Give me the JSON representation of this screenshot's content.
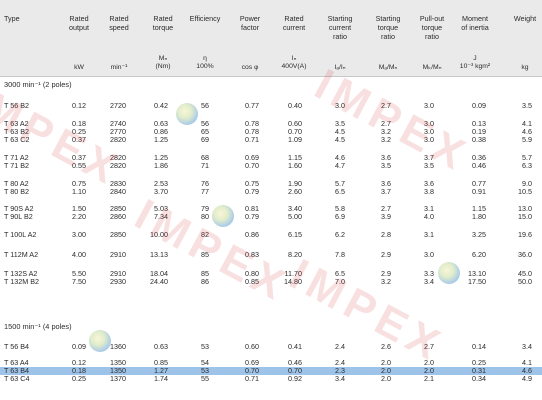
{
  "headers": [
    {
      "key": "type",
      "label": "Type",
      "unit": ""
    },
    {
      "key": "output",
      "label": "Rated\noutput",
      "unit": "kW"
    },
    {
      "key": "speed",
      "label": "Rated\nspeed",
      "unit": "min⁻¹"
    },
    {
      "key": "torque",
      "label": "Rated\ntorque",
      "unit": "Mₙ\n(Nm)"
    },
    {
      "key": "eff",
      "label": "Efficiency",
      "unit": "η\n100%"
    },
    {
      "key": "pf",
      "label": "Power\nfactor",
      "unit": "cos φ"
    },
    {
      "key": "current",
      "label": "Rated\ncurrent",
      "unit": "Iₙ\n400V(A)"
    },
    {
      "key": "scr",
      "label": "Starting\ncurrent\nratio",
      "unit": "Iₐ/Iₙ"
    },
    {
      "key": "str",
      "label": "Starting\ntorque\nratio",
      "unit": "Mₐ/Mₙ"
    },
    {
      "key": "potr",
      "label": "Pull-out\ntorque\nratio",
      "unit": "Mₖ/Mₙ"
    },
    {
      "key": "moi",
      "label": "Moment\nof inertia",
      "unit": "J\n10⁻³ kgm²"
    },
    {
      "key": "weight",
      "label": "Weight",
      "unit": "kg"
    }
  ],
  "sections": [
    {
      "title": "3000 min⁻¹ (2 poles)",
      "rows": [
        [
          "T 56 B2",
          "0.12",
          "2720",
          "0.42",
          "56",
          "0.77",
          "0.40",
          "3.0",
          "2.7",
          "3.0",
          "0.09",
          "3.5"
        ],
        [
          "T 63 A2",
          "0.18",
          "2740",
          "0.63",
          "56",
          "0.78",
          "0.60",
          "3.5",
          "2.7",
          "3.0",
          "0.13",
          "4.1"
        ],
        [
          "T 63 B2",
          "0.25",
          "2770",
          "0.86",
          "65",
          "0.78",
          "0.70",
          "4.5",
          "3.2",
          "3.0",
          "0.19",
          "4.6"
        ],
        [
          "T 63 C2",
          "0.37",
          "2820",
          "1.25",
          "69",
          "0.71",
          "1.09",
          "4.5",
          "3.2",
          "3.0",
          "0.38",
          "5.9"
        ],
        [
          "T 71 A2",
          "0.37",
          "2820",
          "1.25",
          "68",
          "0.69",
          "1.15",
          "4.6",
          "3.6",
          "3.7",
          "0.36",
          "5.7"
        ],
        [
          "T 71 B2",
          "0.55",
          "2820",
          "1.86",
          "71",
          "0.70",
          "1.60",
          "4.7",
          "3.5",
          "3.5",
          "0.46",
          "6.3"
        ],
        [
          "T 80 A2",
          "0.75",
          "2830",
          "2.53",
          "76",
          "0.75",
          "1.90",
          "5.7",
          "3.6",
          "3.6",
          "0.77",
          "9.0"
        ],
        [
          "T 80 B2",
          "1.10",
          "2840",
          "3.70",
          "77",
          "0.79",
          "2.60",
          "6.5",
          "3.7",
          "3.8",
          "0.91",
          "10.5"
        ],
        [
          "T 90S A2",
          "1.50",
          "2850",
          "5.03",
          "79",
          "0.81",
          "3.40",
          "5.8",
          "2.7",
          "3.1",
          "1.15",
          "13.0"
        ],
        [
          "T 90L B2",
          "2.20",
          "2860",
          "7.34",
          "80",
          "0.79",
          "5.00",
          "6.9",
          "3.9",
          "4.0",
          "1.80",
          "15.0"
        ],
        [
          "T 100L A2",
          "3.00",
          "2850",
          "10.00",
          "82",
          "0.86",
          "6.15",
          "6.2",
          "2.8",
          "3.1",
          "3.25",
          "19.6"
        ],
        [
          "T 112M A2",
          "4.00",
          "2910",
          "13.13",
          "85",
          "0.83",
          "8.20",
          "7.8",
          "2.9",
          "3.0",
          "6.20",
          "36.0"
        ],
        [
          "T 132S A2",
          "5.50",
          "2910",
          "18.04",
          "85",
          "0.80",
          "11.70",
          "6.5",
          "2.9",
          "3.3",
          "13.10",
          "45.0"
        ],
        [
          "T 132M B2",
          "7.50",
          "2930",
          "24.40",
          "86",
          "0.85",
          "14.80",
          "7.0",
          "3.2",
          "3.4",
          "17.50",
          "50.0"
        ]
      ]
    },
    {
      "title": "1500 min⁻¹ (4 poles)",
      "rows": [
        [
          "T 56 B4",
          "0.09",
          "1360",
          "0.63",
          "53",
          "0.60",
          "0.41",
          "2.4",
          "2.6",
          "2.7",
          "0.14",
          "3.4"
        ],
        [
          "T 63 A4",
          "0.12",
          "1350",
          "0.85",
          "54",
          "0.69",
          "0.46",
          "2.4",
          "2.0",
          "2.0",
          "0.25",
          "4.1"
        ],
        [
          "T 63 B4",
          "0.18",
          "1350",
          "1.27",
          "53",
          "0.70",
          "0.70",
          "2.3",
          "2.0",
          "2.0",
          "0.31",
          "4.6"
        ],
        [
          "T 63 C4",
          "0.25",
          "1370",
          "1.74",
          "55",
          "0.71",
          "0.92",
          "3.4",
          "2.0",
          "2.1",
          "0.34",
          "4.9"
        ]
      ]
    }
  ],
  "highlight_row": "T 63 B4",
  "watermark": "IMPEX"
}
